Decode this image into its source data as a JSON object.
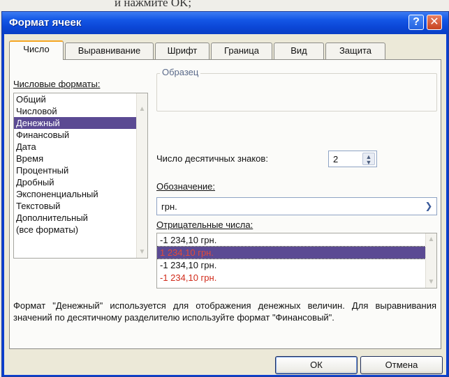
{
  "page_caption_fragment": "и нажмите OK;",
  "window": {
    "title": "Формат ячеек",
    "help_glyph": "?",
    "close_glyph": "✕"
  },
  "tabs": [
    "Число",
    "Выравнивание",
    "Шрифт",
    "Граница",
    "Вид",
    "Защита"
  ],
  "active_tab": "Число",
  "number_formats": {
    "label": "Числовые форматы:",
    "items": [
      "Общий",
      "Числовой",
      "Денежный",
      "Финансовый",
      "Дата",
      "Время",
      "Процентный",
      "Дробный",
      "Экспоненциальный",
      "Текстовый",
      "Дополнительный",
      "(все форматы)"
    ],
    "selected": "Денежный"
  },
  "sample": {
    "legend": "Образец",
    "value": ""
  },
  "decimal_places": {
    "label": "Число десятичных знаков:",
    "value": "2"
  },
  "symbol": {
    "label": "Обозначение:",
    "value": "грн."
  },
  "negative_numbers": {
    "label": "Отрицательные числа:",
    "items": [
      {
        "text": "-1 234,10 грн.",
        "color": "#111111"
      },
      {
        "text": "1 234,10 грн.",
        "color": "#d12a1a"
      },
      {
        "text": "-1 234,10 грн.",
        "color": "#111111"
      },
      {
        "text": "-1 234,10 грн.",
        "color": "#d12a1a"
      }
    ],
    "selected_index": 1
  },
  "description": "Формат \"Денежный\" используется для отображения денежных величин. Для выравнивания значений по десятичному разделителю используйте формат \"Финансовый\".",
  "buttons": {
    "ok": "ОК",
    "cancel": "Отмена"
  },
  "colors": {
    "title_bar": "#0b46d6",
    "selection": "#5b4a93",
    "negative_red": "#d12a1a",
    "active_tab_accent": "#f5a623"
  }
}
